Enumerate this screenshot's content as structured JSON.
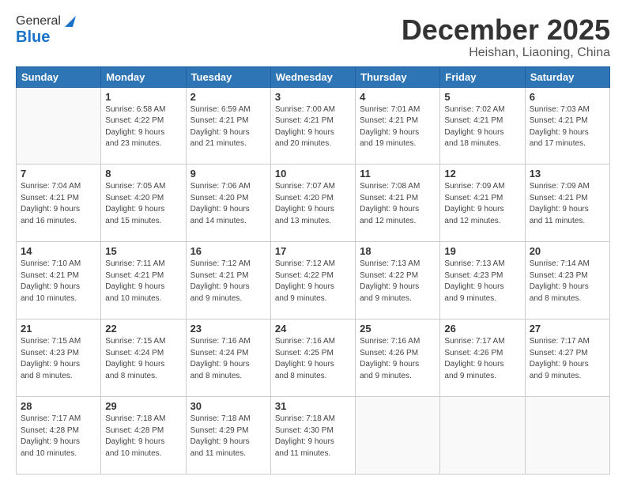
{
  "logo": {
    "general": "General",
    "blue": "Blue"
  },
  "header": {
    "month": "December 2025",
    "location": "Heishan, Liaoning, China"
  },
  "days_of_week": [
    "Sunday",
    "Monday",
    "Tuesday",
    "Wednesday",
    "Thursday",
    "Friday",
    "Saturday"
  ],
  "weeks": [
    [
      {
        "day": "",
        "info": ""
      },
      {
        "day": "1",
        "info": "Sunrise: 6:58 AM\nSunset: 4:22 PM\nDaylight: 9 hours\nand 23 minutes."
      },
      {
        "day": "2",
        "info": "Sunrise: 6:59 AM\nSunset: 4:21 PM\nDaylight: 9 hours\nand 21 minutes."
      },
      {
        "day": "3",
        "info": "Sunrise: 7:00 AM\nSunset: 4:21 PM\nDaylight: 9 hours\nand 20 minutes."
      },
      {
        "day": "4",
        "info": "Sunrise: 7:01 AM\nSunset: 4:21 PM\nDaylight: 9 hours\nand 19 minutes."
      },
      {
        "day": "5",
        "info": "Sunrise: 7:02 AM\nSunset: 4:21 PM\nDaylight: 9 hours\nand 18 minutes."
      },
      {
        "day": "6",
        "info": "Sunrise: 7:03 AM\nSunset: 4:21 PM\nDaylight: 9 hours\nand 17 minutes."
      }
    ],
    [
      {
        "day": "7",
        "info": "Sunrise: 7:04 AM\nSunset: 4:21 PM\nDaylight: 9 hours\nand 16 minutes."
      },
      {
        "day": "8",
        "info": "Sunrise: 7:05 AM\nSunset: 4:20 PM\nDaylight: 9 hours\nand 15 minutes."
      },
      {
        "day": "9",
        "info": "Sunrise: 7:06 AM\nSunset: 4:20 PM\nDaylight: 9 hours\nand 14 minutes."
      },
      {
        "day": "10",
        "info": "Sunrise: 7:07 AM\nSunset: 4:20 PM\nDaylight: 9 hours\nand 13 minutes."
      },
      {
        "day": "11",
        "info": "Sunrise: 7:08 AM\nSunset: 4:21 PM\nDaylight: 9 hours\nand 12 minutes."
      },
      {
        "day": "12",
        "info": "Sunrise: 7:09 AM\nSunset: 4:21 PM\nDaylight: 9 hours\nand 12 minutes."
      },
      {
        "day": "13",
        "info": "Sunrise: 7:09 AM\nSunset: 4:21 PM\nDaylight: 9 hours\nand 11 minutes."
      }
    ],
    [
      {
        "day": "14",
        "info": "Sunrise: 7:10 AM\nSunset: 4:21 PM\nDaylight: 9 hours\nand 10 minutes."
      },
      {
        "day": "15",
        "info": "Sunrise: 7:11 AM\nSunset: 4:21 PM\nDaylight: 9 hours\nand 10 minutes."
      },
      {
        "day": "16",
        "info": "Sunrise: 7:12 AM\nSunset: 4:21 PM\nDaylight: 9 hours\nand 9 minutes."
      },
      {
        "day": "17",
        "info": "Sunrise: 7:12 AM\nSunset: 4:22 PM\nDaylight: 9 hours\nand 9 minutes."
      },
      {
        "day": "18",
        "info": "Sunrise: 7:13 AM\nSunset: 4:22 PM\nDaylight: 9 hours\nand 9 minutes."
      },
      {
        "day": "19",
        "info": "Sunrise: 7:13 AM\nSunset: 4:23 PM\nDaylight: 9 hours\nand 9 minutes."
      },
      {
        "day": "20",
        "info": "Sunrise: 7:14 AM\nSunset: 4:23 PM\nDaylight: 9 hours\nand 8 minutes."
      }
    ],
    [
      {
        "day": "21",
        "info": "Sunrise: 7:15 AM\nSunset: 4:23 PM\nDaylight: 9 hours\nand 8 minutes."
      },
      {
        "day": "22",
        "info": "Sunrise: 7:15 AM\nSunset: 4:24 PM\nDaylight: 9 hours\nand 8 minutes."
      },
      {
        "day": "23",
        "info": "Sunrise: 7:16 AM\nSunset: 4:24 PM\nDaylight: 9 hours\nand 8 minutes."
      },
      {
        "day": "24",
        "info": "Sunrise: 7:16 AM\nSunset: 4:25 PM\nDaylight: 9 hours\nand 8 minutes."
      },
      {
        "day": "25",
        "info": "Sunrise: 7:16 AM\nSunset: 4:26 PM\nDaylight: 9 hours\nand 9 minutes."
      },
      {
        "day": "26",
        "info": "Sunrise: 7:17 AM\nSunset: 4:26 PM\nDaylight: 9 hours\nand 9 minutes."
      },
      {
        "day": "27",
        "info": "Sunrise: 7:17 AM\nSunset: 4:27 PM\nDaylight: 9 hours\nand 9 minutes."
      }
    ],
    [
      {
        "day": "28",
        "info": "Sunrise: 7:17 AM\nSunset: 4:28 PM\nDaylight: 9 hours\nand 10 minutes."
      },
      {
        "day": "29",
        "info": "Sunrise: 7:18 AM\nSunset: 4:28 PM\nDaylight: 9 hours\nand 10 minutes."
      },
      {
        "day": "30",
        "info": "Sunrise: 7:18 AM\nSunset: 4:29 PM\nDaylight: 9 hours\nand 11 minutes."
      },
      {
        "day": "31",
        "info": "Sunrise: 7:18 AM\nSunset: 4:30 PM\nDaylight: 9 hours\nand 11 minutes."
      },
      {
        "day": "",
        "info": ""
      },
      {
        "day": "",
        "info": ""
      },
      {
        "day": "",
        "info": ""
      }
    ]
  ]
}
